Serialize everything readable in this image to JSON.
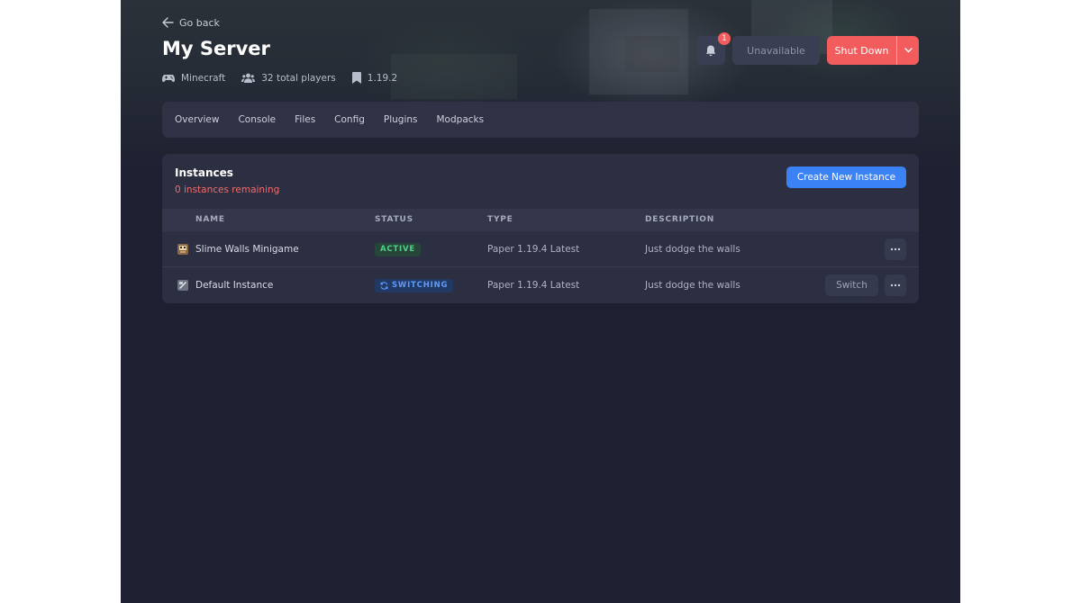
{
  "nav": {
    "back_label": "Go back"
  },
  "server": {
    "title": "My Server",
    "game": "Minecraft",
    "players": "32 total players",
    "version": "1.19.2"
  },
  "header_actions": {
    "notification_count": "1",
    "unavailable_label": "Unavailable",
    "shutdown_label": "Shut Down"
  },
  "tabs": [
    "Overview",
    "Console",
    "Files",
    "Config",
    "Plugins",
    "Modpacks"
  ],
  "instances": {
    "title": "Instances",
    "remaining": "0 instances remaining",
    "create_label": "Create New Instance",
    "columns": [
      "NAME",
      "STATUS",
      "TYPE",
      "DESCRIPTION"
    ],
    "rows": [
      {
        "name": "Slime Walls Minigame",
        "status": "ACTIVE",
        "type": "Paper 1.19.4 Latest",
        "description": "Just dodge the walls"
      },
      {
        "name": "Default Instance",
        "status": "SWITCHING",
        "type": "Paper 1.19.4 Latest",
        "description": "Just dodge the walls",
        "action": "Switch"
      }
    ]
  },
  "colors": {
    "accent": "#3b82f6",
    "danger": "#f25c5c",
    "active": "#4fd18b",
    "switching": "#5b9bff",
    "background": "#1e2031"
  }
}
